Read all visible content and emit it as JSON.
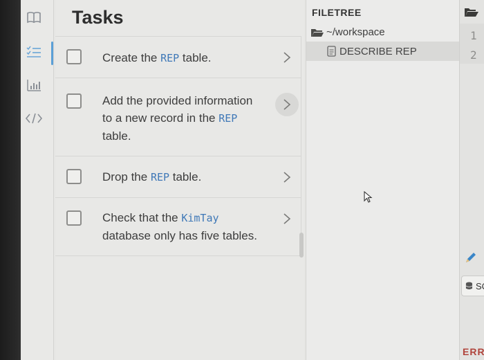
{
  "left_rail": {
    "items": [
      {
        "name": "book-icon"
      },
      {
        "name": "task-list-icon",
        "active": true
      },
      {
        "name": "chart-icon"
      },
      {
        "name": "code-icon"
      }
    ]
  },
  "tasks": {
    "title": "Tasks",
    "items": [
      {
        "text_before": "Create the ",
        "code": "REP",
        "text_after": " table."
      },
      {
        "text_before": "Add the provided information to a new record in the ",
        "code": "REP",
        "text_after": " table."
      },
      {
        "text_before": "Drop the ",
        "code": "REP",
        "text_after": " table."
      },
      {
        "text_before": "Check that the ",
        "code": "KimTay",
        "text_after": " database only has five tables."
      }
    ]
  },
  "filetree": {
    "title": "FILETREE",
    "folder": "~/workspace",
    "file": "DESCRIBE REP"
  },
  "editor": {
    "line_numbers": [
      "1",
      "2"
    ],
    "run_button_label": "SC",
    "error_label": "ERR"
  },
  "colors": {
    "accent": "#5a9fd6",
    "code_text": "#3f78b7",
    "error": "#b0443c"
  }
}
